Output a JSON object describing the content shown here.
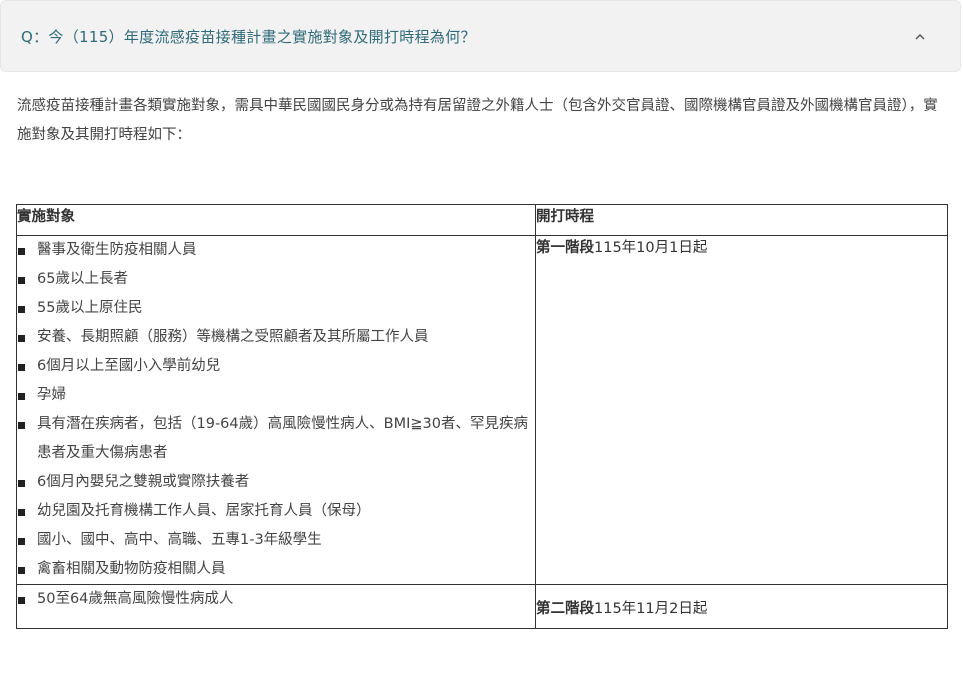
{
  "faq": {
    "question": "Q：今（115）年度流感疫苗接種計畫之實施對象及開打時程為何？",
    "toggle_icon": "chevron-up-icon",
    "accent": "#2f6a78"
  },
  "intro": {
    "text": "流感疫苗接種計畫各類實施對象，需具中華民國國民身分或為持有居留證之外籍人士（包含外交官員證、國際機構官員證及外國機構官員證），實施對象及其開打時程如下："
  },
  "table": {
    "headers": [
      "實施對象",
      "開打時程"
    ],
    "rows": [
      {
        "targets": [
          "醫事及衛生防疫相關人員",
          "65歲以上長者",
          "55歲以上原住民",
          "安養、長期照顧（服務）等機構之受照顧者及其所屬工作人員",
          "6個月以上至國小入學前幼兒",
          "孕婦",
          "具有潛在疾病者，包括（19-64歲）高風險慢性病人、BMI≧30者、罕見疾病患者及重大傷病患者",
          "6個月內嬰兒之雙親或實際扶養者",
          "幼兒園及托育機構工作人員、居家托育人員（保母）",
          "國小、國中、高中、高職、五專1-3年級學生",
          "禽畜相關及動物防疫相關人員"
        ],
        "stage": "第一階段",
        "start": "115年10月1日起"
      },
      {
        "targets": [
          "50至64歲無高風險慢性病成人"
        ],
        "stage": "第二階段",
        "start": "115年11月2日起"
      }
    ]
  }
}
